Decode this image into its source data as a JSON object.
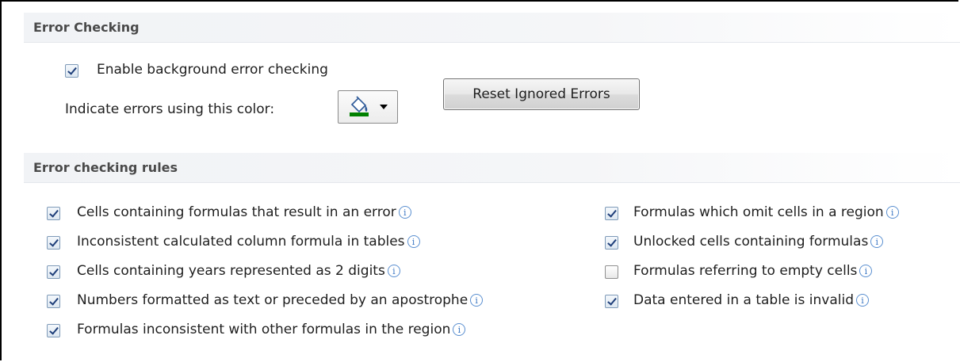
{
  "section_error_checking": {
    "title": "Error Checking",
    "enable_background": {
      "label": "Enable background error checking",
      "checked": true
    },
    "indicate_color_label": "Indicate errors using this color:",
    "indicate_color": {
      "swatch": "#008000",
      "icon": "paint-bucket-icon"
    },
    "reset_button_label": "Reset Ignored Errors"
  },
  "section_rules": {
    "title": "Error checking rules",
    "left_rules": [
      {
        "label": "Cells containing formulas that result in an error",
        "checked": true
      },
      {
        "label": "Inconsistent calculated column formula in tables",
        "checked": true
      },
      {
        "label": "Cells containing years represented as 2 digits",
        "checked": true
      },
      {
        "label": "Numbers formatted as text or preceded by an apostrophe",
        "checked": true
      },
      {
        "label": "Formulas inconsistent with other formulas in the region",
        "checked": true
      }
    ],
    "right_rules": [
      {
        "label": "Formulas which omit cells in a region",
        "checked": true
      },
      {
        "label": "Unlocked cells containing formulas",
        "checked": true
      },
      {
        "label": "Formulas referring to empty cells",
        "checked": false
      },
      {
        "label": "Data entered in a table is invalid",
        "checked": true
      }
    ],
    "info_glyph": "i"
  }
}
